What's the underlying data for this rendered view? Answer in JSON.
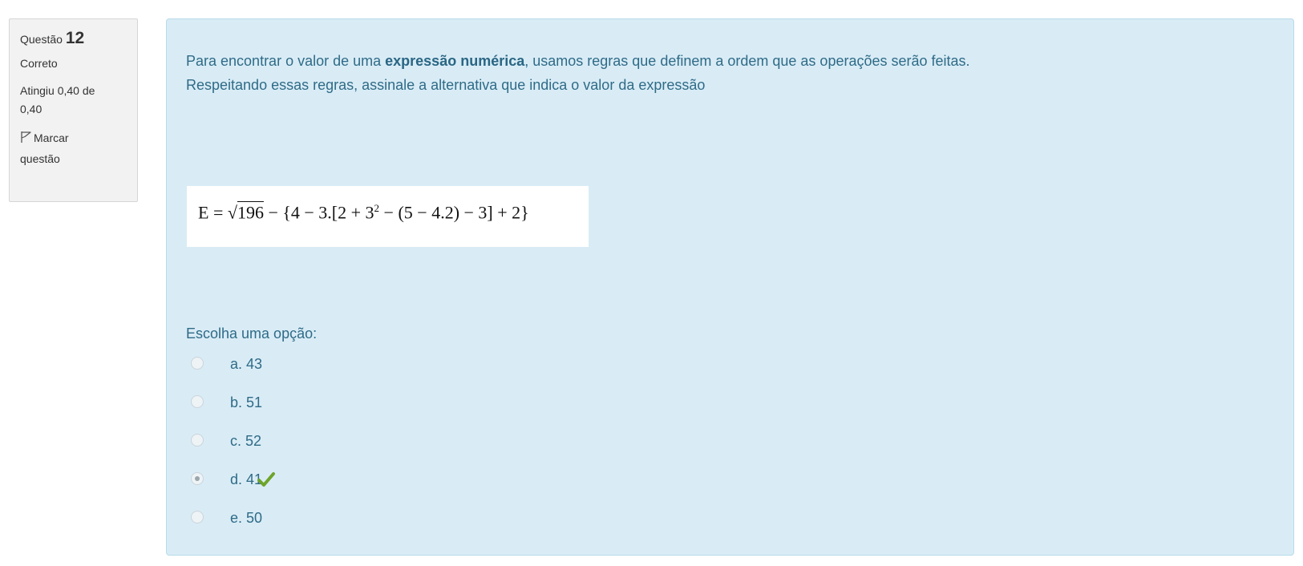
{
  "info": {
    "question_word": "Questão",
    "question_number": "12",
    "state": "Correto",
    "grade_line1": "Atingiu 0,40 de",
    "grade_line2": "0,40",
    "flag_line1": "Marcar",
    "flag_line2": "questão",
    "flag_icon": "flag-outline-icon"
  },
  "question": {
    "text_prefix": "Para encontrar o valor de uma ",
    "text_bold": "expressão numérica",
    "text_suffix": ", usamos regras que definem a ordem que as operações serão feitas.",
    "text_line2": "Respeitando essas regras, assinale a alternativa que indica o valor da expressão",
    "formula": {
      "lhs": "E = ",
      "sqrt_symbol": "√",
      "radicand": "196",
      "part1": " − {4 − 3.[2 + 3",
      "exponent": "2",
      "part2": " − (5 − 4.2) − 3] + 2}"
    }
  },
  "answer": {
    "prompt": "Escolha uma opção:",
    "options": [
      {
        "letter": "a.",
        "value": "43"
      },
      {
        "letter": "b.",
        "value": "51"
      },
      {
        "letter": "c.",
        "value": "52"
      },
      {
        "letter": "d.",
        "value": "41"
      },
      {
        "letter": "e.",
        "value": "50"
      }
    ],
    "selected_index": 3,
    "correct_icon": "checkmark-icon"
  },
  "colors": {
    "content_bg": "#d9ecf6",
    "content_text": "#2f6b87",
    "info_bg": "#f2f2f2",
    "check_green": "#6ea42a"
  }
}
